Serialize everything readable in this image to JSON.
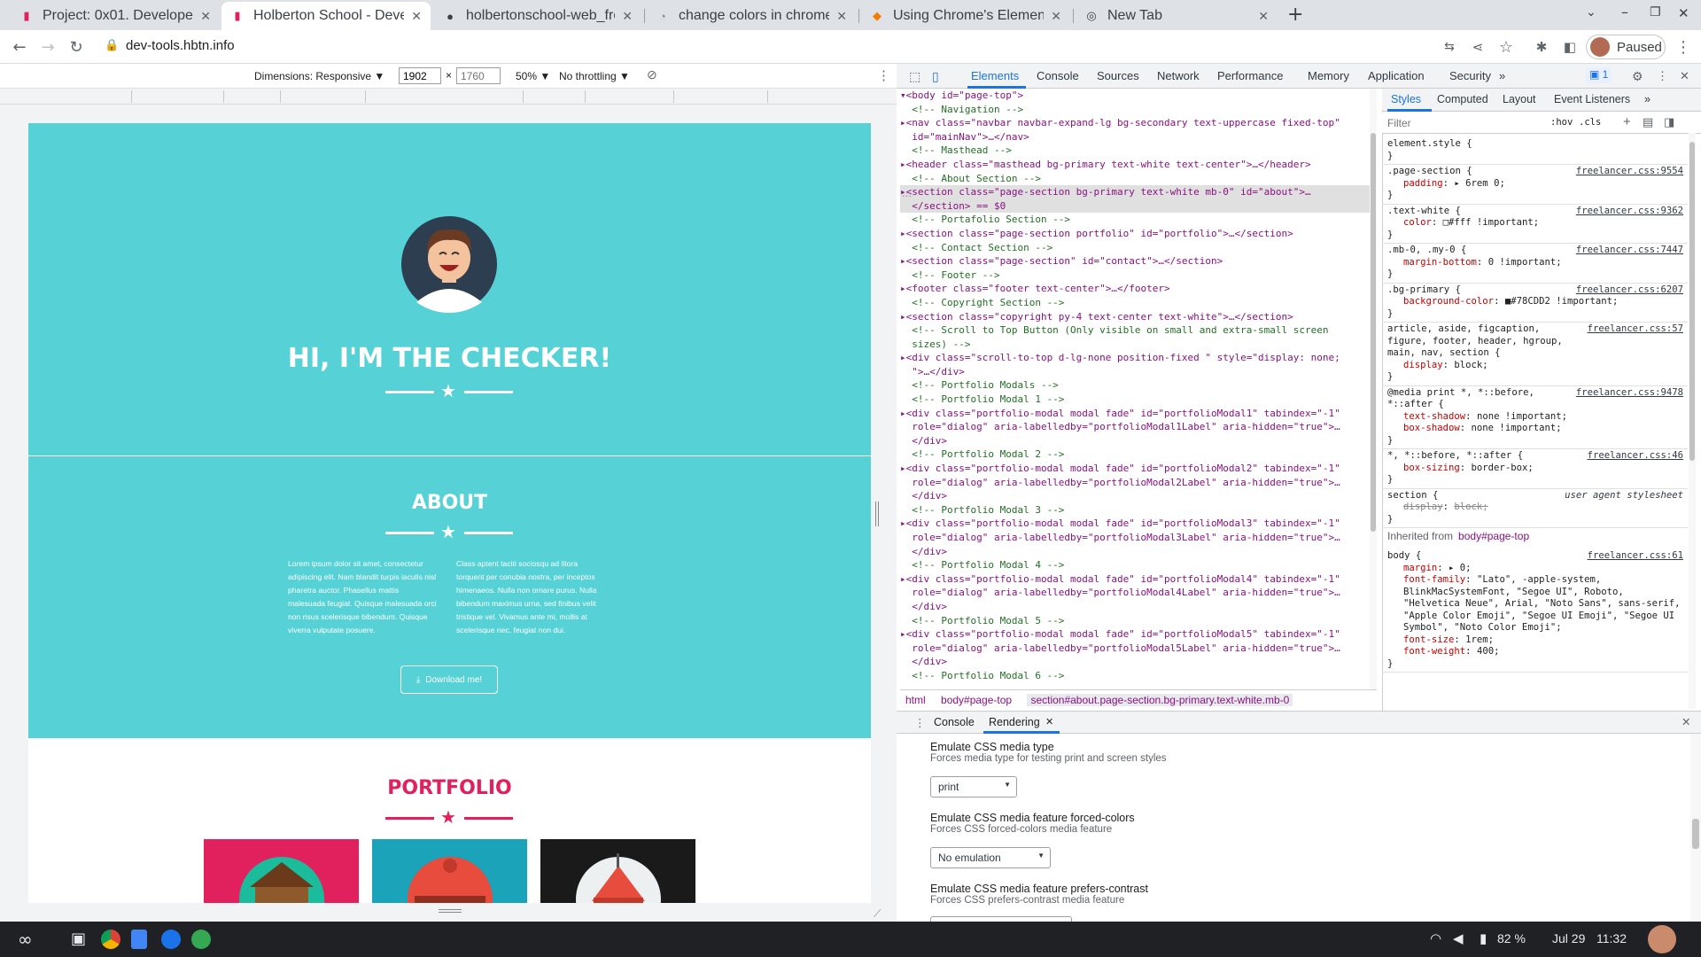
{
  "tabs": [
    {
      "title": "Project: 0x01. Developer",
      "icon": "holberton-icon"
    },
    {
      "title": "Holberton School - Deve",
      "icon": "holberton-icon",
      "active": true
    },
    {
      "title": "holbertonschool-web_fro",
      "icon": "github-icon"
    },
    {
      "title": "change colors in chrome",
      "icon": "page-icon"
    },
    {
      "title": "Using Chrome's Element",
      "icon": "page-icon"
    },
    {
      "title": "New Tab",
      "icon": "chrome-icon"
    }
  ],
  "toolbar": {
    "url": "dev-tools.hbtn.info",
    "profile_status": "Paused"
  },
  "device_toolbar": {
    "dimensions_label": "Dimensions: Responsive ▼",
    "width": "1902",
    "height_placeholder": "1760",
    "times": "×",
    "zoom": "50% ▼",
    "throttling": "No throttling ▼"
  },
  "page": {
    "hero_title": "HI, I'M THE CHECKER!",
    "about_title": "ABOUT",
    "about_left": "Lorem ipsum dolor sit amet, consectetur adipiscing elit. Nam blandit turpis iaculis nisl pharetra auctor. Phasellus mattis malesuada feugiat. Quisque malesuada orci non risus scelerisque bibendum. Quisque viverra vulputate posuere.",
    "about_right": "Class aptent taciti sociosqu ad litora torquent per conubia nostra, per inceptos himenaeos. Nulla non ornare purus. Nulla bibendum maximus urna, sed finibus velit tristique vel. Vivamus ante mi, mollis at scelerisque nec, feugiat non dui.",
    "download_label": "Download me!",
    "portfolio_title": "PORTFOLIO",
    "colors": {
      "primary": "#56d1d6",
      "portfolio": "#e0215e"
    }
  },
  "devtools": {
    "tabs": [
      "Elements",
      "Console",
      "Sources",
      "Network",
      "Performance",
      "Memory",
      "Application",
      "Security",
      "»"
    ],
    "issues_badge": "1",
    "elements_lines": [
      {
        "t": "▾<body id=\"page-top\">",
        "k": "tag"
      },
      {
        "t": "  <!-- Navigation -->",
        "k": "comment"
      },
      {
        "t": "▸<nav class=\"navbar navbar-expand-lg bg-secondary text-uppercase fixed-top\"",
        "k": "tag"
      },
      {
        "t": "  id=\"mainNav\">…</nav>",
        "k": "tag"
      },
      {
        "t": "  <!-- Masthead -->",
        "k": "comment"
      },
      {
        "t": "▸<header class=\"masthead bg-primary text-white text-center\">…</header>",
        "k": "tag"
      },
      {
        "t": "  <!-- About Section -->",
        "k": "comment"
      },
      {
        "t": "▸<section class=\"page-section bg-primary text-white mb-0\" id=\"about\">…",
        "k": "tag",
        "sel": true
      },
      {
        "t": "  </section> == $0",
        "k": "tag",
        "sel": true
      },
      {
        "t": "  <!-- Portafolio Section -->",
        "k": "comment"
      },
      {
        "t": "▸<section class=\"page-section portfolio\" id=\"portfolio\">…</section>",
        "k": "tag"
      },
      {
        "t": "  <!-- Contact Section -->",
        "k": "comment"
      },
      {
        "t": "▸<section class=\"page-section\" id=\"contact\">…</section>",
        "k": "tag"
      },
      {
        "t": "  <!-- Footer -->",
        "k": "comment"
      },
      {
        "t": "▸<footer class=\"footer text-center\">…</footer>",
        "k": "tag"
      },
      {
        "t": "  <!-- Copyright Section -->",
        "k": "comment"
      },
      {
        "t": "▸<section class=\"copyright py-4 text-center text-white\">…</section>",
        "k": "tag"
      },
      {
        "t": "  <!-- Scroll to Top Button (Only visible on small and extra-small screen",
        "k": "comment"
      },
      {
        "t": "  sizes) -->",
        "k": "comment"
      },
      {
        "t": "▸<div class=\"scroll-to-top d-lg-none position-fixed \" style=\"display: none;",
        "k": "tag"
      },
      {
        "t": "  \">…</div>",
        "k": "tag"
      },
      {
        "t": "  <!-- Portfolio Modals -->",
        "k": "comment"
      },
      {
        "t": "  <!-- Portfolio Modal 1 -->",
        "k": "comment"
      },
      {
        "t": "▸<div class=\"portfolio-modal modal fade\" id=\"portfolioModal1\" tabindex=\"-1\"",
        "k": "tag"
      },
      {
        "t": "  role=\"dialog\" aria-labelledby=\"portfolioModal1Label\" aria-hidden=\"true\">…",
        "k": "tag"
      },
      {
        "t": "  </div>",
        "k": "tag"
      },
      {
        "t": "  <!-- Portfolio Modal 2 -->",
        "k": "comment"
      },
      {
        "t": "▸<div class=\"portfolio-modal modal fade\" id=\"portfolioModal2\" tabindex=\"-1\"",
        "k": "tag"
      },
      {
        "t": "  role=\"dialog\" aria-labelledby=\"portfolioModal2Label\" aria-hidden=\"true\">…",
        "k": "tag"
      },
      {
        "t": "  </div>",
        "k": "tag"
      },
      {
        "t": "  <!-- Portfolio Modal 3 -->",
        "k": "comment"
      },
      {
        "t": "▸<div class=\"portfolio-modal modal fade\" id=\"portfolioModal3\" tabindex=\"-1\"",
        "k": "tag"
      },
      {
        "t": "  role=\"dialog\" aria-labelledby=\"portfolioModal3Label\" aria-hidden=\"true\">…",
        "k": "tag"
      },
      {
        "t": "  </div>",
        "k": "tag"
      },
      {
        "t": "  <!-- Portfolio Modal 4 -->",
        "k": "comment"
      },
      {
        "t": "▸<div class=\"portfolio-modal modal fade\" id=\"portfolioModal4\" tabindex=\"-1\"",
        "k": "tag"
      },
      {
        "t": "  role=\"dialog\" aria-labelledby=\"portfolioModal4Label\" aria-hidden=\"true\">…",
        "k": "tag"
      },
      {
        "t": "  </div>",
        "k": "tag"
      },
      {
        "t": "  <!-- Portfolio Modal 5 -->",
        "k": "comment"
      },
      {
        "t": "▸<div class=\"portfolio-modal modal fade\" id=\"portfolioModal5\" tabindex=\"-1\"",
        "k": "tag"
      },
      {
        "t": "  role=\"dialog\" aria-labelledby=\"portfolioModal5Label\" aria-hidden=\"true\">…",
        "k": "tag"
      },
      {
        "t": "  </div>",
        "k": "tag"
      },
      {
        "t": "  <!-- Portfolio Modal 6 -->",
        "k": "comment"
      }
    ],
    "breadcrumbs": [
      "html",
      "body#page-top",
      "section#about.page-section.bg-primary.text-white.mb-0"
    ],
    "styles_tabs": [
      "Styles",
      "Computed",
      "Layout",
      "Event Listeners",
      "»"
    ],
    "filter_placeholder": "Filter",
    "filter_hov": ":hov",
    "filter_cls": ".cls",
    "rules": [
      {
        "sel": "element.style {",
        "src": "",
        "props": [],
        "close": "}"
      },
      {
        "sel": ".page-section {",
        "src": "freelancer.css:9554",
        "props": [
          {
            "n": "padding",
            "v": "▸ 6rem 0;"
          }
        ],
        "close": "}"
      },
      {
        "sel": ".text-white {",
        "src": "freelancer.css:9362",
        "props": [
          {
            "n": "color",
            "v": "□#fff !important;"
          }
        ],
        "close": "}"
      },
      {
        "sel": ".mb-0, .my-0 {",
        "src": "freelancer.css:7447",
        "props": [
          {
            "n": "margin-bottom",
            "v": "0 !important;"
          }
        ],
        "close": "}"
      },
      {
        "sel": ".bg-primary {",
        "src": "freelancer.css:6207",
        "props": [
          {
            "n": "background-color",
            "v": "■#78CDD2 !important;"
          }
        ],
        "close": "}"
      },
      {
        "sel": "article, aside, figcaption, figure, footer, header, hgroup, main, nav, section {",
        "src": "freelancer.css:57",
        "props": [
          {
            "n": "display",
            "v": "block;"
          }
        ],
        "close": "}"
      },
      {
        "sel": "@media print *, *::before, *::after {",
        "src": "freelancer.css:9478",
        "props": [
          {
            "n": "text-shadow",
            "v": "none !important;"
          },
          {
            "n": "box-shadow",
            "v": "none !important;"
          }
        ],
        "close": "}"
      },
      {
        "sel": "*, *::before, *::after {",
        "src": "freelancer.css:46",
        "props": [
          {
            "n": "box-sizing",
            "v": "border-box;"
          }
        ],
        "close": "}"
      },
      {
        "sel": "section {",
        "src": "user agent stylesheet",
        "props": [
          {
            "n": "display",
            "v": "block;"
          }
        ],
        "close": "}"
      }
    ],
    "inherited_label": "Inherited from",
    "inherited_from": "body#page-top",
    "body_rule": {
      "sel": "body {",
      "src": "freelancer.css:61",
      "props": [
        {
          "n": "margin",
          "v": "▸ 0;"
        },
        {
          "n": "font-family",
          "v": "\"Lato\", -apple-system, BlinkMacSystemFont, \"Segoe UI\", Roboto, \"Helvetica Neue\", Arial, \"Noto Sans\", sans-serif, \"Apple Color Emoji\", \"Segoe UI Emoji\", \"Segoe UI Symbol\", \"Noto Color Emoji\";"
        },
        {
          "n": "font-size",
          "v": "1rem;"
        },
        {
          "n": "font-weight",
          "v": "400;"
        }
      ]
    },
    "drawer_tabs": [
      "Console",
      "Rendering"
    ],
    "rendering": [
      {
        "title": "Emulate CSS media type",
        "desc": "Forces media type for testing print and screen styles",
        "value": "print"
      },
      {
        "title": "Emulate CSS media feature forced-colors",
        "desc": "Forces CSS forced-colors media feature",
        "value": "No emulation"
      },
      {
        "title": "Emulate CSS media feature prefers-contrast",
        "desc": "Forces CSS prefers-contrast media feature",
        "value": ""
      }
    ]
  },
  "taskbar": {
    "battery": "82 %",
    "date": "Jul 29",
    "time": "11:32"
  }
}
